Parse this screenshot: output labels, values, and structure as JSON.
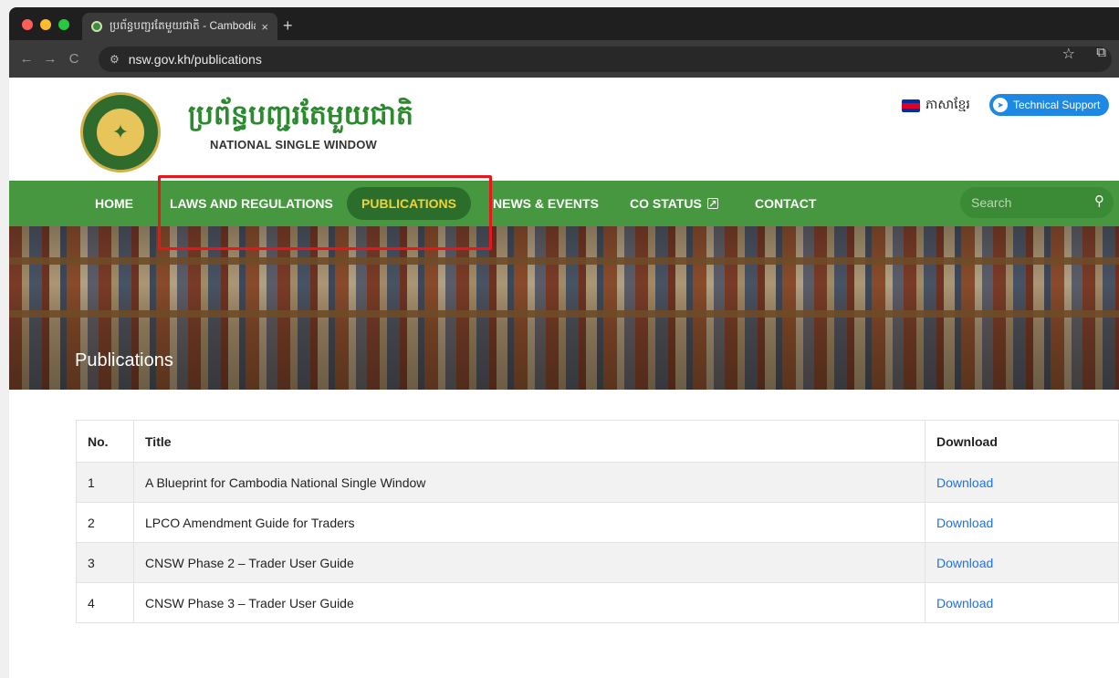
{
  "browser": {
    "tab_title": "ប្រព័ន្ធបញ្ជរតែមួយជាតិ - Cambodia",
    "tab_close": "×",
    "new_tab": "+",
    "url": "nsw.gov.kh/publications",
    "back": "←",
    "forward": "→",
    "reload": "C"
  },
  "header": {
    "brand_kh": "ប្រព័ន្ធបញ្ជរតែមួយជាតិ",
    "brand_en": "NATIONAL SINGLE WINDOW",
    "language_label": "ភាសាខ្មែរ",
    "support_label": "Technical Support"
  },
  "nav": {
    "items": [
      {
        "label": "HOME"
      },
      {
        "label": "LAWS AND REGULATIONS"
      },
      {
        "label": "PUBLICATIONS"
      },
      {
        "label": "NEWS & EVENTS"
      },
      {
        "label": "CO STATUS"
      },
      {
        "label": "CONTACT"
      }
    ],
    "search_placeholder": "Search"
  },
  "banner": {
    "title": "Publications"
  },
  "table": {
    "headers": [
      "No.",
      "Title",
      "Download"
    ],
    "rows": [
      {
        "no": "1",
        "title": "A Blueprint for Cambodia National Single Window",
        "download": "Download"
      },
      {
        "no": "2",
        "title": "LPCO Amendment Guide for Traders",
        "download": "Download"
      },
      {
        "no": "3",
        "title": "CNSW Phase 2 – Trader User Guide",
        "download": "Download"
      },
      {
        "no": "4",
        "title": "CNSW Phase 3 – Trader User Guide",
        "download": "Download"
      }
    ]
  },
  "colors": {
    "nav_green": "#46973f",
    "active_pill": "#2b6e2b",
    "active_text": "#f1d23a",
    "link_blue": "#1a73e8",
    "highlight_red": "#e8151b"
  }
}
